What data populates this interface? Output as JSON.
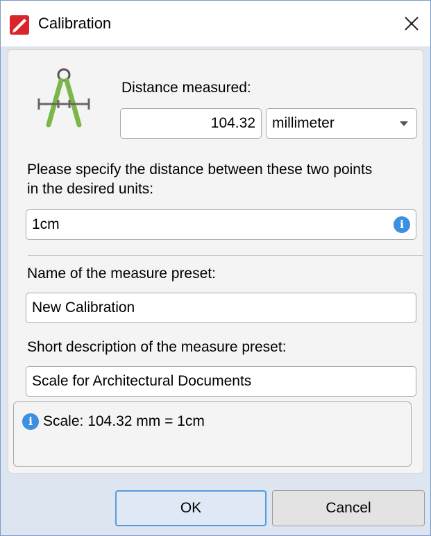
{
  "window": {
    "title": "Calibration"
  },
  "calibration": {
    "distance_label": "Distance measured:",
    "distance_value": "104.32",
    "unit": {
      "selected": "millimeter"
    },
    "specify_label_line1": "Please specify the distance between these two points",
    "specify_label_line2": "in the desired units:",
    "desired_value": "1cm"
  },
  "preset": {
    "name_label": "Name of the measure preset:",
    "name_value": "New Calibration",
    "description_label": "Short description of the measure preset:",
    "description_value": "Scale for Architectural Documents"
  },
  "summary": {
    "text": "Scale: 104.32 mm = 1cm"
  },
  "buttons": {
    "ok": "OK",
    "cancel": "Cancel"
  },
  "icons": {
    "app": "pdf-app-icon",
    "close": "close-icon",
    "calibration": "compass-icon",
    "info": "info-icon",
    "dropdown": "chevron-down-icon"
  },
  "colors": {
    "accent": "#3d8fe0",
    "app_icon": "#d9262a",
    "compass": "#7ab648",
    "dialog_bg": "#dce5f0"
  }
}
